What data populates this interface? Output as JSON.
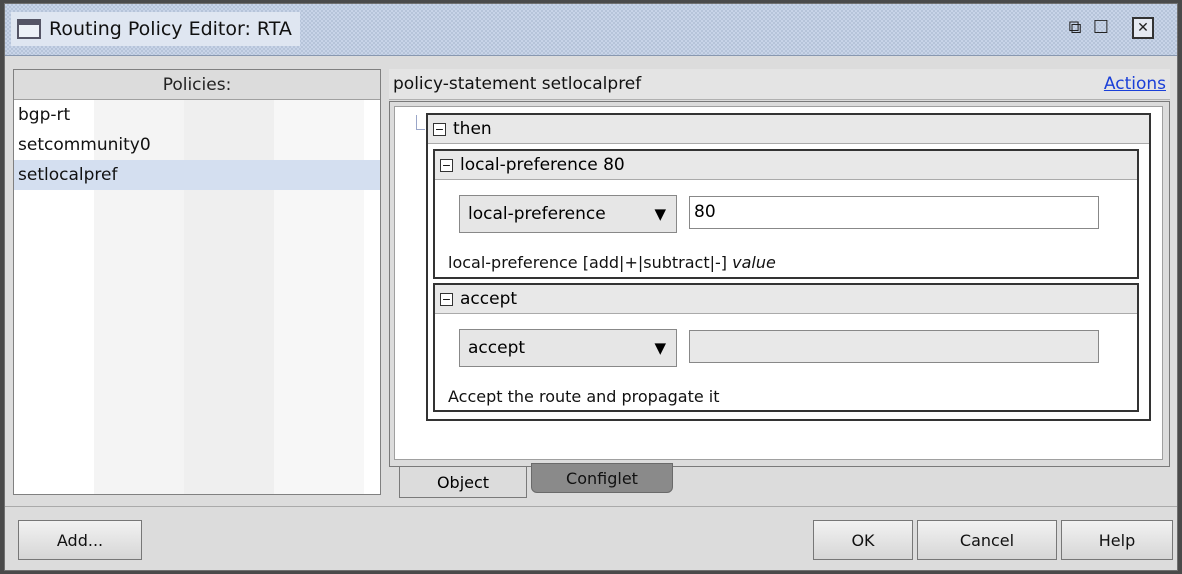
{
  "window": {
    "title": "Routing Policy Editor: RTA",
    "restore_glyph": "⧉",
    "maximize_glyph": "☐",
    "close_glyph": "✕"
  },
  "left_panel": {
    "header": "Policies:",
    "items": [
      {
        "label": "bgp-rt",
        "selected": false
      },
      {
        "label": "setcommunity0",
        "selected": false
      },
      {
        "label": "setlocalpref",
        "selected": true
      }
    ]
  },
  "right_panel": {
    "statement": "policy-statement setlocalpref",
    "actions_link": "Actions",
    "then_box": {
      "label": "then",
      "toggle": "−",
      "local_pref": {
        "label": "local-preference 80",
        "toggle": "−",
        "dropdown_value": "local-preference",
        "dropdown_arrow": "▼",
        "input_value": "80",
        "description_prefix": "local-preference [add|+|subtract|-] ",
        "description_italic": "value"
      },
      "accept": {
        "label": "accept",
        "toggle": "−",
        "dropdown_value": "accept",
        "dropdown_arrow": "▼",
        "input_value": "",
        "description": "Accept the route and propagate it"
      }
    },
    "tabs": {
      "object": "Object",
      "configlet": "Configlet"
    }
  },
  "buttons": {
    "add": "Add...",
    "ok": "OK",
    "cancel": "Cancel",
    "help": "Help"
  },
  "colors": {
    "link": "#1a3fd8",
    "selection": "#d4dff0",
    "titlebar": "#c8d4e8"
  }
}
